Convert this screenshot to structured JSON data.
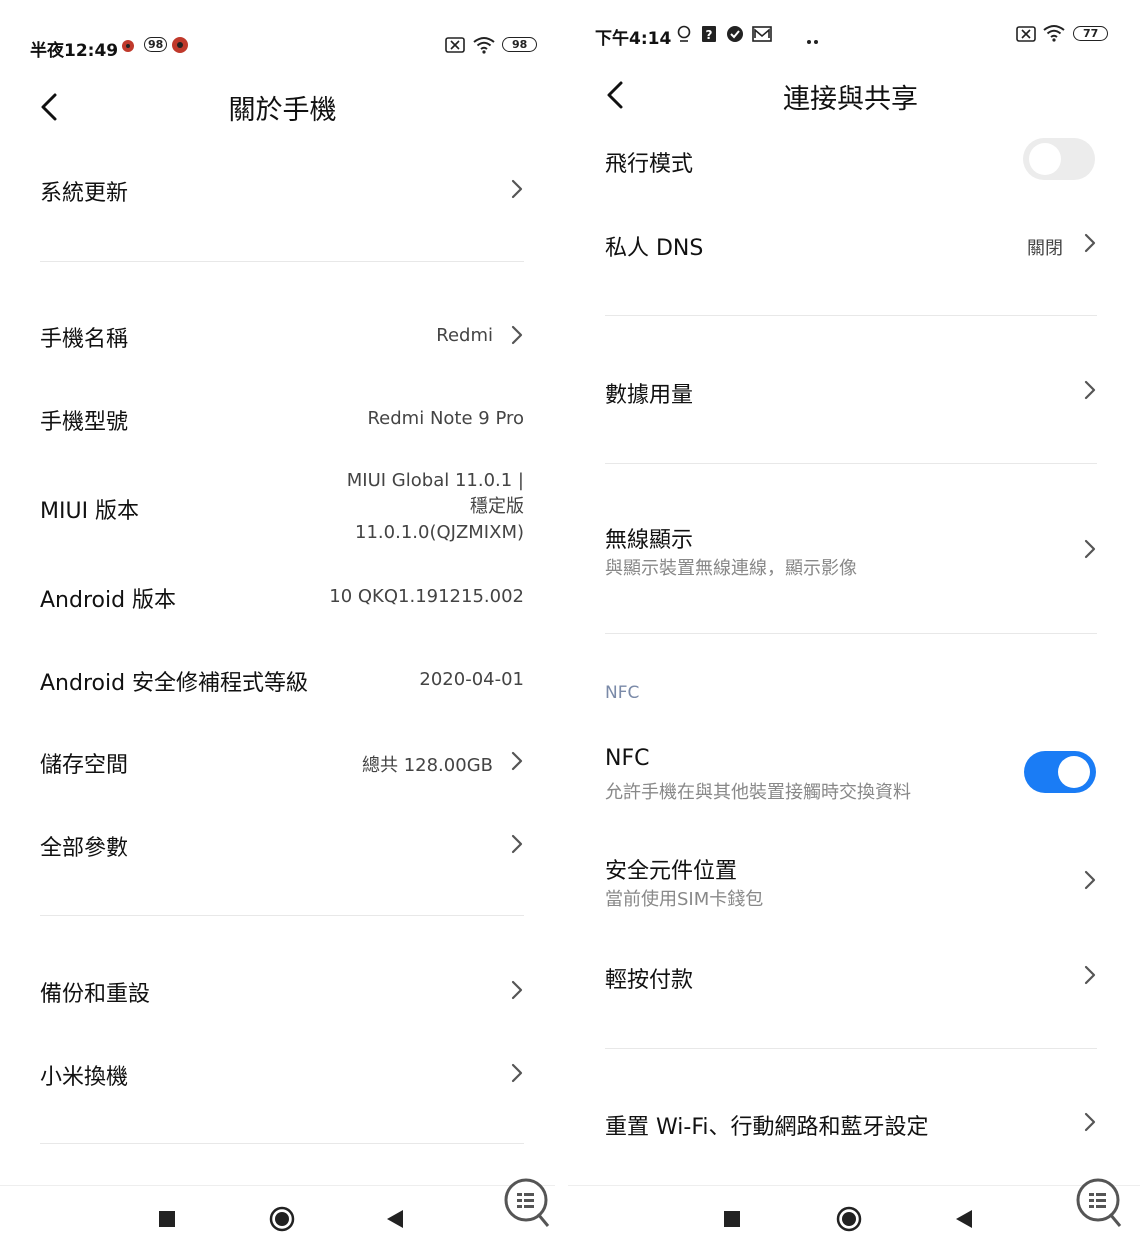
{
  "left": {
    "status": {
      "time": "半夜12:49",
      "notif_badge": "98",
      "battery": "98"
    },
    "title": "關於手機",
    "items": [
      {
        "label": "系統更新",
        "value": ""
      },
      {
        "label": "手機名稱",
        "value": "Redmi"
      },
      {
        "label": "手機型號",
        "value": "Redmi Note 9 Pro"
      },
      {
        "label": "MIUI 版本",
        "value": "MIUI Global 11.0.1 |\n穩定版\n11.0.1.0(QJZMIXM)"
      },
      {
        "label": "Android 版本",
        "value": "10 QKQ1.191215.002"
      },
      {
        "label": "Android 安全修補程式等級",
        "value": "2020-04-01"
      },
      {
        "label": "儲存空間",
        "value": "總共 128.00GB"
      },
      {
        "label": "全部參數",
        "value": ""
      },
      {
        "label": "備份和重設",
        "value": ""
      },
      {
        "label": "小米換機",
        "value": ""
      }
    ]
  },
  "right": {
    "status": {
      "time": "下午4:14",
      "battery": "77"
    },
    "title": "連接與共享",
    "items": [
      {
        "label": "飛行模式",
        "toggle": false
      },
      {
        "label": "私人 DNS",
        "value": "關閉"
      },
      {
        "label": "數據用量"
      },
      {
        "label": "無線顯示",
        "sub": "與顯示裝置無線連線，顯示影像"
      },
      {
        "label": "NFC",
        "sub": "允許手機在與其他裝置接觸時交換資料",
        "toggle": true
      },
      {
        "label": "安全元件位置",
        "sub": "當前使用SIM卡錢包"
      },
      {
        "label": "輕按付款"
      },
      {
        "label": "重置 Wi-Fi、行動網路和藍牙設定"
      }
    ],
    "section_nfc": "NFC"
  },
  "colors": {
    "accent": "#1a7cf5",
    "toggle_off": "#ececec",
    "divider": "#e8e8e8"
  },
  "icons": [
    "back-arrow-icon",
    "chevron-right-icon",
    "wifi-icon",
    "sim-x-icon",
    "recent-apps-icon",
    "home-icon",
    "back-triangle-icon",
    "feedback-icon"
  ]
}
